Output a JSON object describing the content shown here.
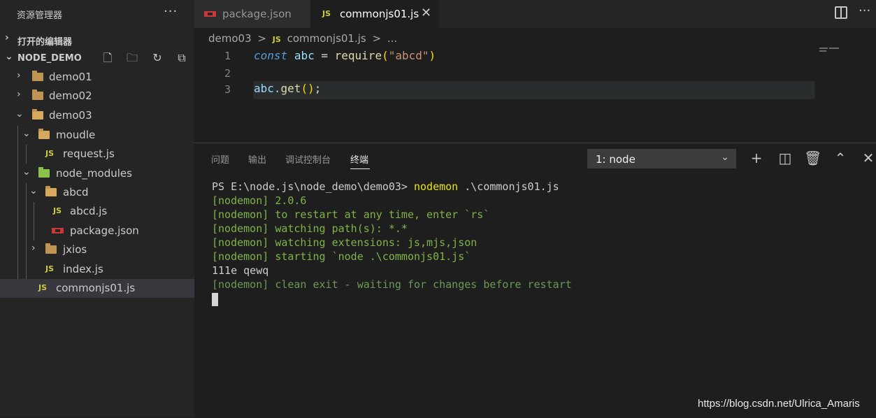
{
  "sidebar": {
    "title": "资源管理器",
    "more": "···",
    "open_editors": "打开的编辑器",
    "project": "NODE_DEMO",
    "tree": [
      {
        "label": "demo01",
        "type": "folder",
        "expanded": false
      },
      {
        "label": "demo02",
        "type": "folder",
        "expanded": false
      },
      {
        "label": "demo03",
        "type": "folder",
        "expanded": true
      },
      {
        "label": "moudle",
        "type": "folder",
        "expanded": true
      },
      {
        "label": "request.js",
        "type": "js"
      },
      {
        "label": "node_modules",
        "type": "folder",
        "expanded": true
      },
      {
        "label": "abcd",
        "type": "folder",
        "expanded": true
      },
      {
        "label": "abcd.js",
        "type": "js"
      },
      {
        "label": "package.json",
        "type": "npm"
      },
      {
        "label": "jxios",
        "type": "folder",
        "expanded": false
      },
      {
        "label": "index.js",
        "type": "js"
      },
      {
        "label": "commonjs01.js",
        "type": "js",
        "selected": true
      }
    ]
  },
  "tabs": [
    {
      "label": "package.json",
      "active": false
    },
    {
      "label": "commonjs01.js",
      "active": true
    }
  ],
  "breadcrumb": {
    "folder": "demo03",
    "sep": ">",
    "file": "commonjs01.js",
    "ellipsis": "..."
  },
  "editor": {
    "line_numbers": [
      "1",
      "2",
      "3"
    ],
    "line1": {
      "kw": "const",
      "id": "abc",
      "op": "=",
      "fn": "require",
      "open": "(",
      "str": "\"abcd\"",
      "close": ")"
    },
    "line3": {
      "id": "abc.",
      "fn": "get",
      "open": "(",
      "close": ")",
      "semi": ";"
    }
  },
  "panel": {
    "tabs": [
      "问题",
      "输出",
      "调试控制台",
      "终端"
    ],
    "active_tab": "终端",
    "terminal_select": "1: node",
    "prompt": "PS E:\\node.js\\node_demo\\demo03>",
    "command": "nodemon",
    "command_args": ".\\commonjs01.js",
    "tag": "[nodemon]",
    "lines": [
      "2.0.6",
      "to restart at any time, enter `rs`",
      "watching path(s): *.*",
      "watching extensions: js,mjs,json",
      "starting `node .\\commonjs01.js`"
    ],
    "output": "111e qewq",
    "final_line": "clean exit - waiting for changes before restart"
  },
  "watermark": "https://blog.csdn.net/Ulrica_Amaris",
  "colors": {
    "accent_yellow": "#cbcb41",
    "terminal_green": "#89d185",
    "nodemon_tag": "#7fb347"
  }
}
